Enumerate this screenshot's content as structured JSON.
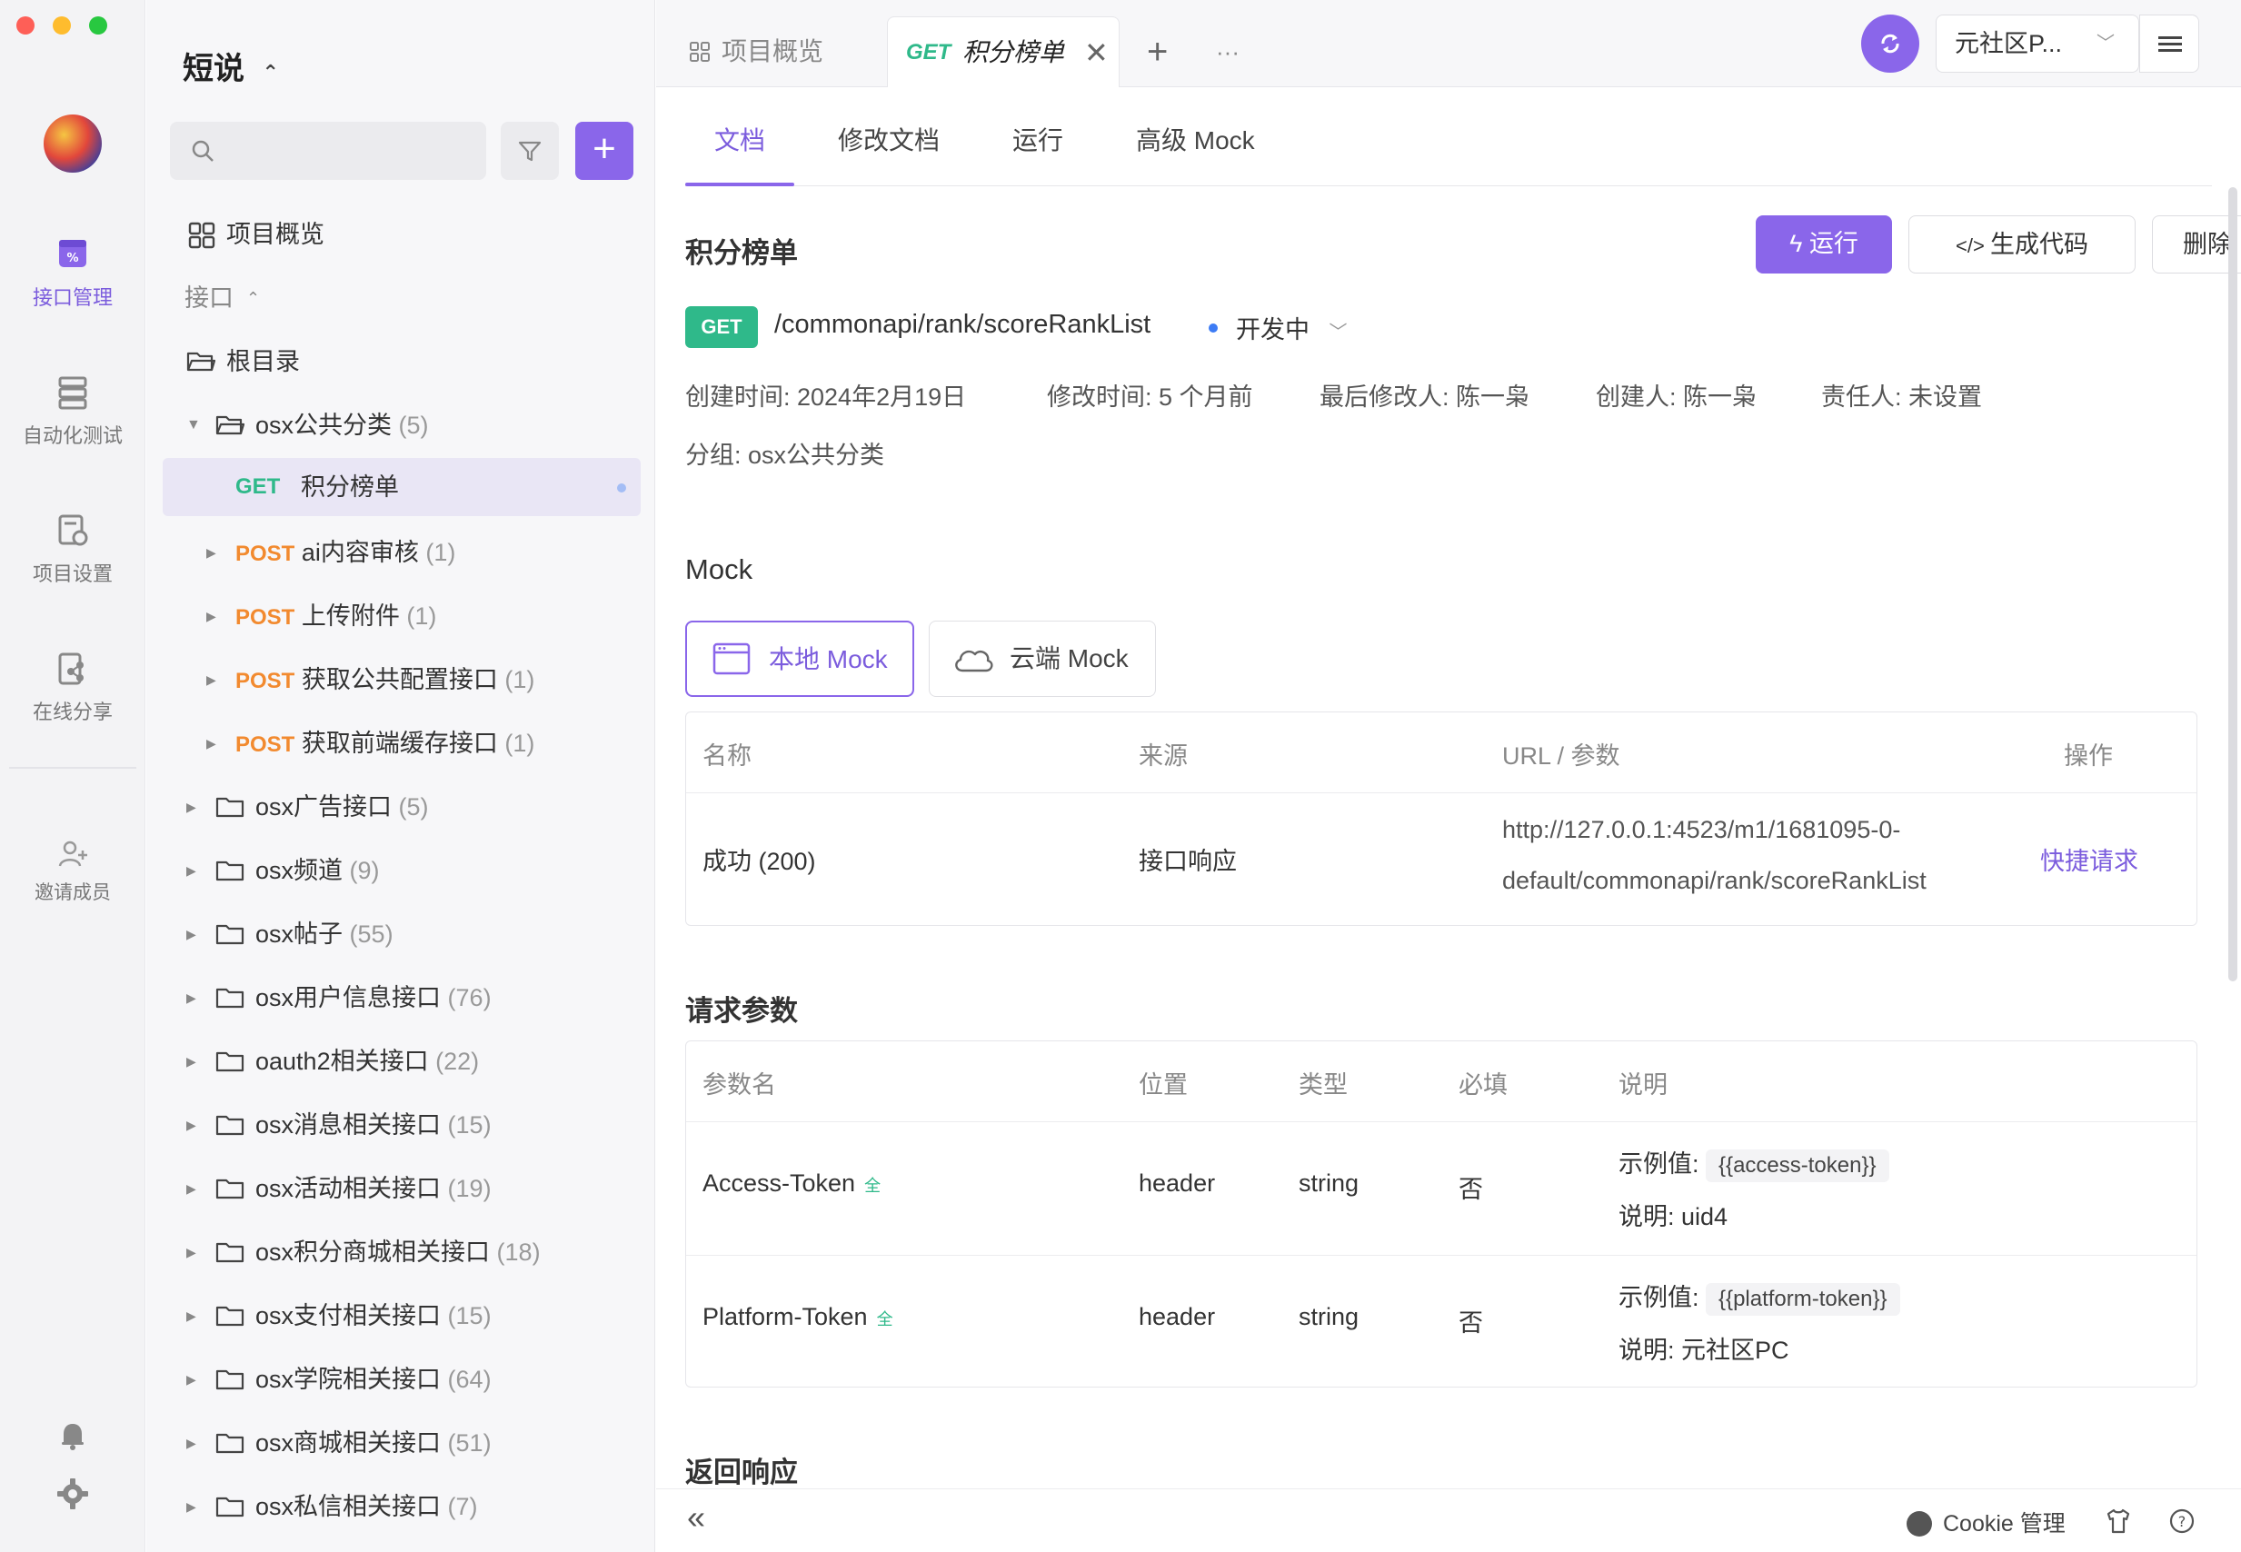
{
  "window": {
    "traffic_colors": [
      "#fe5f57",
      "#febc2e",
      "#28c840"
    ]
  },
  "rail": {
    "items": [
      {
        "label": "接口管理",
        "icon": "api-manage-icon",
        "active": true
      },
      {
        "label": "自动化测试",
        "icon": "automation-icon",
        "active": false
      },
      {
        "label": "项目设置",
        "icon": "settings-doc-icon",
        "active": false
      },
      {
        "label": "在线分享",
        "icon": "share-icon",
        "active": false
      }
    ],
    "invite_label": "邀请成员"
  },
  "sidebar": {
    "project_name": "短说",
    "overview_label": "项目概览",
    "api_section_label": "接口",
    "root_label": "根目录",
    "open_folder": {
      "name": "osx公共分类",
      "count": "(5)"
    },
    "endpoints": [
      {
        "method": "GET",
        "name": "积分榜单",
        "count": ""
      },
      {
        "method": "POST",
        "name": "ai内容审核",
        "count": "(1)"
      },
      {
        "method": "POST",
        "name": "上传附件",
        "count": "(1)"
      },
      {
        "method": "POST",
        "name": "获取公共配置接口",
        "count": "(1)"
      },
      {
        "method": "POST",
        "name": "获取前端缓存接口",
        "count": "(1)"
      }
    ],
    "folders": [
      {
        "name": "osx广告接口",
        "count": "(5)"
      },
      {
        "name": "osx频道",
        "count": "(9)"
      },
      {
        "name": "osx帖子",
        "count": "(55)"
      },
      {
        "name": "osx用户信息接口",
        "count": "(76)"
      },
      {
        "name": "oauth2相关接口",
        "count": "(22)"
      },
      {
        "name": "osx消息相关接口",
        "count": "(15)"
      },
      {
        "name": "osx活动相关接口",
        "count": "(19)"
      },
      {
        "name": "osx积分商城相关接口",
        "count": "(18)"
      },
      {
        "name": "osx支付相关接口",
        "count": "(15)"
      },
      {
        "name": "osx学院相关接口",
        "count": "(64)"
      },
      {
        "name": "osx商城相关接口",
        "count": "(51)"
      },
      {
        "name": "osx私信相关接口",
        "count": "(7)"
      }
    ]
  },
  "tabs": {
    "overview_label": "项目概览",
    "active_method": "GET",
    "active_name": "积分榜单",
    "more_label": "···",
    "team_name": "元社区P..."
  },
  "subtabs": [
    "文档",
    "修改文档",
    "运行",
    "高级 Mock"
  ],
  "doc": {
    "title": "积分榜单",
    "run_label": "运行",
    "gen_code_label": "生成代码",
    "delete_label": "删除",
    "method": "GET",
    "path": "/commonapi/rank/scoreRankList",
    "status": "开发中",
    "meta": {
      "created": "创建时间: 2024年2月19日",
      "modified": "修改时间: 5 个月前",
      "last_modifier": "最后修改人: 陈一枭",
      "creator": "创建人: 陈一枭",
      "owner": "责任人: 未设置",
      "group": "分组: osx公共分类"
    }
  },
  "mock": {
    "title": "Mock",
    "local_label": "本地 Mock",
    "cloud_label": "云端 Mock",
    "headers": [
      "名称",
      "来源",
      "URL / 参数",
      "操作"
    ],
    "row": {
      "name": "成功 (200)",
      "source": "接口响应",
      "url_line1": "http://127.0.0.1:4523/m1/1681095-0-",
      "url_line2": "default/commonapi/rank/scoreRankList",
      "action": "快捷请求"
    }
  },
  "params": {
    "title": "请求参数",
    "headers": [
      "参数名",
      "位置",
      "类型",
      "必填",
      "说明"
    ],
    "rows": [
      {
        "name": "Access-Token",
        "mark": "全",
        "position": "header",
        "type": "string",
        "required": "否",
        "example_label": "示例值:",
        "example": "{{access-token}}",
        "desc_label": "说明:",
        "desc": "uid4"
      },
      {
        "name": "Platform-Token",
        "mark": "全",
        "position": "header",
        "type": "string",
        "required": "否",
        "example_label": "示例值:",
        "example": "{{platform-token}}",
        "desc_label": "说明:",
        "desc": "元社区PC"
      }
    ]
  },
  "response": {
    "title": "返回响应"
  },
  "statusbar": {
    "cookie_label": "Cookie 管理"
  },
  "colors": {
    "accent": "#8a66ea",
    "get": "#2fb98a",
    "post": "#f28a2f"
  }
}
